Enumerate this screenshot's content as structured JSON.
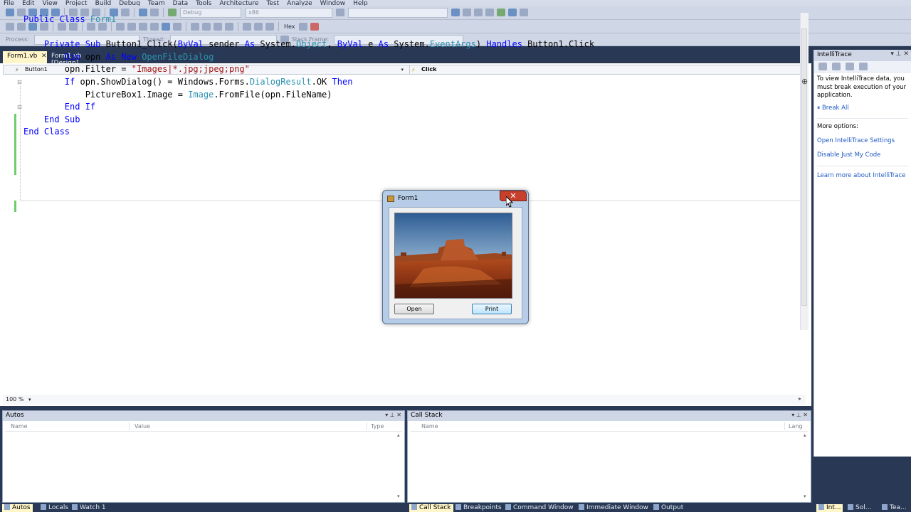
{
  "menubar": {
    "items": [
      "File",
      "Edit",
      "View",
      "Project",
      "Build",
      "Debug",
      "Team",
      "Data",
      "Tools",
      "Architecture",
      "Test",
      "Analyze",
      "Window",
      "Help"
    ]
  },
  "toolbar1": {
    "config": "Debug",
    "platform": "x86"
  },
  "toolbar2": {
    "hex_label": "Hex"
  },
  "toolbar3": {
    "process_label": "Process:",
    "thread_label": "Thread:",
    "stack_frame_label": "Stack Frame:"
  },
  "doc_tabs": [
    {
      "label": "Form1.vb",
      "active": true
    },
    {
      "label": "Form1.vb [Design]",
      "active": false
    }
  ],
  "editor": {
    "nav_left": "Button1",
    "nav_right": "Click",
    "zoom": "100 %",
    "code_lines": [
      [
        {
          "t": "Public Class ",
          "c": "kw"
        },
        {
          "t": "Form1",
          "c": "ty"
        }
      ],
      [],
      [
        {
          "t": "    "
        },
        {
          "t": "Private Sub ",
          "c": "kw"
        },
        {
          "t": "Button1_Click("
        },
        {
          "t": "ByVal ",
          "c": "kw"
        },
        {
          "t": "sender "
        },
        {
          "t": "As ",
          "c": "kw"
        },
        {
          "t": "System."
        },
        {
          "t": "Object",
          "c": "ty"
        },
        {
          "t": ", "
        },
        {
          "t": "ByVal ",
          "c": "kw"
        },
        {
          "t": "e "
        },
        {
          "t": "As ",
          "c": "kw"
        },
        {
          "t": "System."
        },
        {
          "t": "EventArgs",
          "c": "ty"
        },
        {
          "t": ") "
        },
        {
          "t": "Handles ",
          "c": "kw"
        },
        {
          "t": "Button1.Click"
        }
      ],
      [
        {
          "t": "        "
        },
        {
          "t": "Dim ",
          "c": "kw"
        },
        {
          "t": "opn "
        },
        {
          "t": "As New ",
          "c": "kw"
        },
        {
          "t": "OpenFileDialog",
          "c": "ty"
        }
      ],
      [
        {
          "t": "        opn.Filter = "
        },
        {
          "t": "\"Images|*.jpg;jpeg;png\"",
          "c": "st"
        }
      ],
      [
        {
          "t": "        "
        },
        {
          "t": "If ",
          "c": "kw"
        },
        {
          "t": "opn.ShowDialog() = Windows.Forms."
        },
        {
          "t": "DialogResult",
          "c": "ty"
        },
        {
          "t": ".OK "
        },
        {
          "t": "Then",
          "c": "kw"
        }
      ],
      [
        {
          "t": "            PictureBox1.Image = "
        },
        {
          "t": "Image",
          "c": "ty"
        },
        {
          "t": ".FromFile(opn.FileName)"
        }
      ],
      [
        {
          "t": "        "
        },
        {
          "t": "End If",
          "c": "kw"
        }
      ],
      [
        {
          "t": "    "
        },
        {
          "t": "End Sub",
          "c": "kw"
        }
      ],
      [
        {
          "t": "End Class",
          "c": "kw"
        }
      ]
    ]
  },
  "intellitrace": {
    "title": "IntelliTrace",
    "message": "To view IntelliTrace data, you must break execution of your application.",
    "break_all": "Break All",
    "more_options": "More options:",
    "link_settings": "Open IntelliTrace Settings",
    "link_just_my_code": "Disable Just My Code",
    "link_learn_more": "Learn more about IntelliTrace"
  },
  "autos": {
    "title": "Autos",
    "columns": [
      "Name",
      "Value",
      "Type"
    ]
  },
  "callstack": {
    "title": "Call Stack",
    "columns": [
      "Name",
      "Lang"
    ]
  },
  "bottom_tabs_left": [
    "Autos",
    "Locals",
    "Watch 1"
  ],
  "bottom_tabs_right": [
    "Call Stack",
    "Breakpoints",
    "Command Window",
    "Immediate Window",
    "Output"
  ],
  "bottom_tabs_far": [
    "Int...",
    "Sol...",
    "Tea..."
  ],
  "dialog": {
    "title": "Form1",
    "open_label": "Open",
    "print_label": "Print"
  },
  "icons": {
    "close": "close-icon",
    "pin": "pin-icon",
    "dropdown": "chevron-down-icon"
  },
  "colors": {
    "chrome": "#293955",
    "active_tab": "#fff6c9",
    "keyword": "#0000ff",
    "type": "#2b91af",
    "string": "#a31515",
    "link": "#1e59c3"
  }
}
